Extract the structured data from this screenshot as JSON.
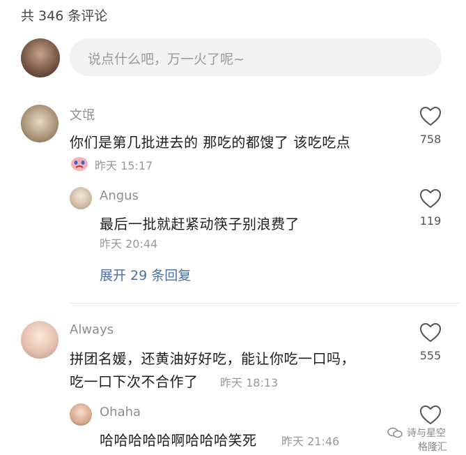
{
  "header": {
    "comment_count": "共 346 条评论"
  },
  "composer": {
    "placeholder": "说点什么吧，万一火了呢~"
  },
  "comments": [
    {
      "user": "文氓",
      "text": "你们是第几批进去的 那吃的都馊了 该吃吃点",
      "time": "昨天 15:17",
      "likes": "758",
      "replies": [
        {
          "user": "Angus",
          "text": "最后一批就赶紧动筷子别浪费了",
          "time": "昨天 20:44",
          "likes": "119"
        }
      ],
      "expand": "展开 29 条回复"
    },
    {
      "user": "Always",
      "text_line1": "拼团名媛，还黄油好好吃，能让你吃一口吗，",
      "text_line2": "吃一口下次不合作了",
      "time": "昨天 18:13",
      "likes": "555",
      "replies": [
        {
          "user": "Ohaha",
          "text": "哈哈哈哈哈啊哈哈哈笑死",
          "time": "昨天 21:46"
        }
      ]
    }
  ],
  "watermark": {
    "line1": "诗与星空",
    "line2": "格隆汇"
  }
}
